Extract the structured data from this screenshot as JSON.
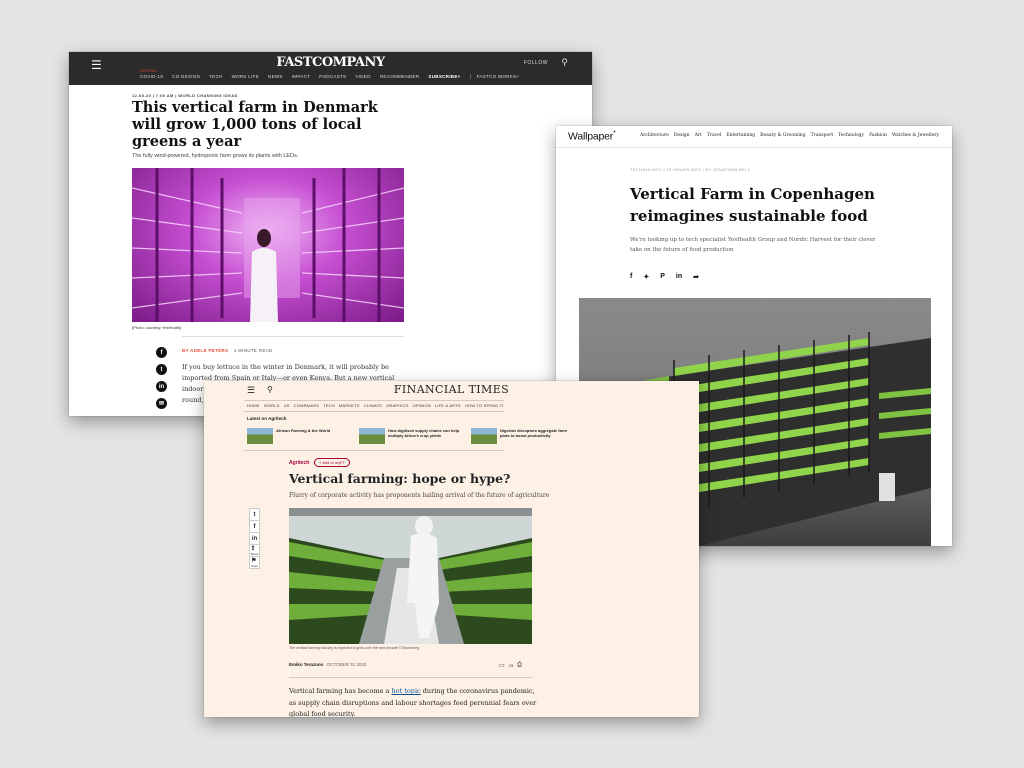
{
  "fastcompany": {
    "logo": "FASTCOMPANY",
    "follow": "FOLLOW",
    "nav": {
      "covid_tag": "SPECIAL",
      "items": [
        "COVID-19",
        "CO.DESIGN",
        "TECH",
        "WORK LIFE",
        "NEWS",
        "IMPACT",
        "PODCASTS",
        "VIDEO",
        "RECOMMENDER"
      ],
      "subscribe": "SUBSCRIBE+",
      "works": "FASTCO WORKS+"
    },
    "meta": "12-08-20 | 7:00 AM | WORLD CHANGING IDEAS",
    "title": "This vertical farm in Denmark will grow 1,000 tons of local greens a year",
    "dek": "The fully wind-powered, hydroponic farm grows its plants with LEDs.",
    "credit": "[Photo: courtesy YesHealth]",
    "byline": "BY ADELE PETERS",
    "read_time": "1 MINUTE READ",
    "body": "If you buy lettuce in the winter in Denmark, it will probably be imported from Spain or Italy—or even Kenya. But a new vertical indoor farm near Copenhagen will produce local greens year-round, compa"
  },
  "wallpaper": {
    "logo": "Wallpaper",
    "logo_mark": "*",
    "nav": [
      "Architecture",
      "Design",
      "Art",
      "Travel",
      "Entertaining",
      "Beauty & Grooming",
      "Transport",
      "Technology",
      "Fashion",
      "Watches & Jewellery"
    ],
    "meta": "TECHNOLOGY | 15 HOURS AGO | BY JONATHAN BELL",
    "title": "Vertical Farm in Copenhagen reimagines sustainable food",
    "dek": "We're looking up to tech specialist YesHealth Group and Nordic Harvest for their clever take on the future of food production"
  },
  "ft": {
    "logo": "FINANCIAL TIMES",
    "nav": [
      "HOME",
      "WORLD",
      "US",
      "COMPANIES",
      "TECH",
      "MARKETS",
      "CLIMATE",
      "GRAPHICS",
      "OPINION",
      "LIFE & ARTS",
      "HOW TO SPEND IT"
    ],
    "latest_label": "Latest on Agritech",
    "latest": [
      "African Farming & the World",
      "How digitised supply chains can help multiply Africa's crop yields",
      "Nigerian disruptors aggregate farm plots to boost productivity"
    ],
    "section": "Agritech",
    "add_myft": "+ Add to myFT",
    "title": "Vertical farming: hope or hype?",
    "dek": "Flurry of corporate activity has proponents hailing arrival of the future of agriculture",
    "tools": {
      "share": "Share",
      "save": "Save"
    },
    "caption": "The vertical farming industry is expected to grow over the next decade © Bloomberg",
    "author": "Emiko Terazono",
    "date": "OCTOBER 31 2020",
    "comment_count": "23",
    "body_pre": "Vertical farming has become a ",
    "body_link": "hot topic",
    "body_post": " during the coronavirus pandemic, as supply chain disruptions and labour shortages feed perennial fears over global food security."
  },
  "colors": {
    "fc_bar": "#2b2b2b",
    "fc_accent": "#e74c3c",
    "ft_bg": "#fdf1e6",
    "ft_claret": "#a4003a",
    "ft_link": "#0f5499",
    "farm_led_purple": "#c64fd2",
    "farm_green": "#9be04a"
  }
}
